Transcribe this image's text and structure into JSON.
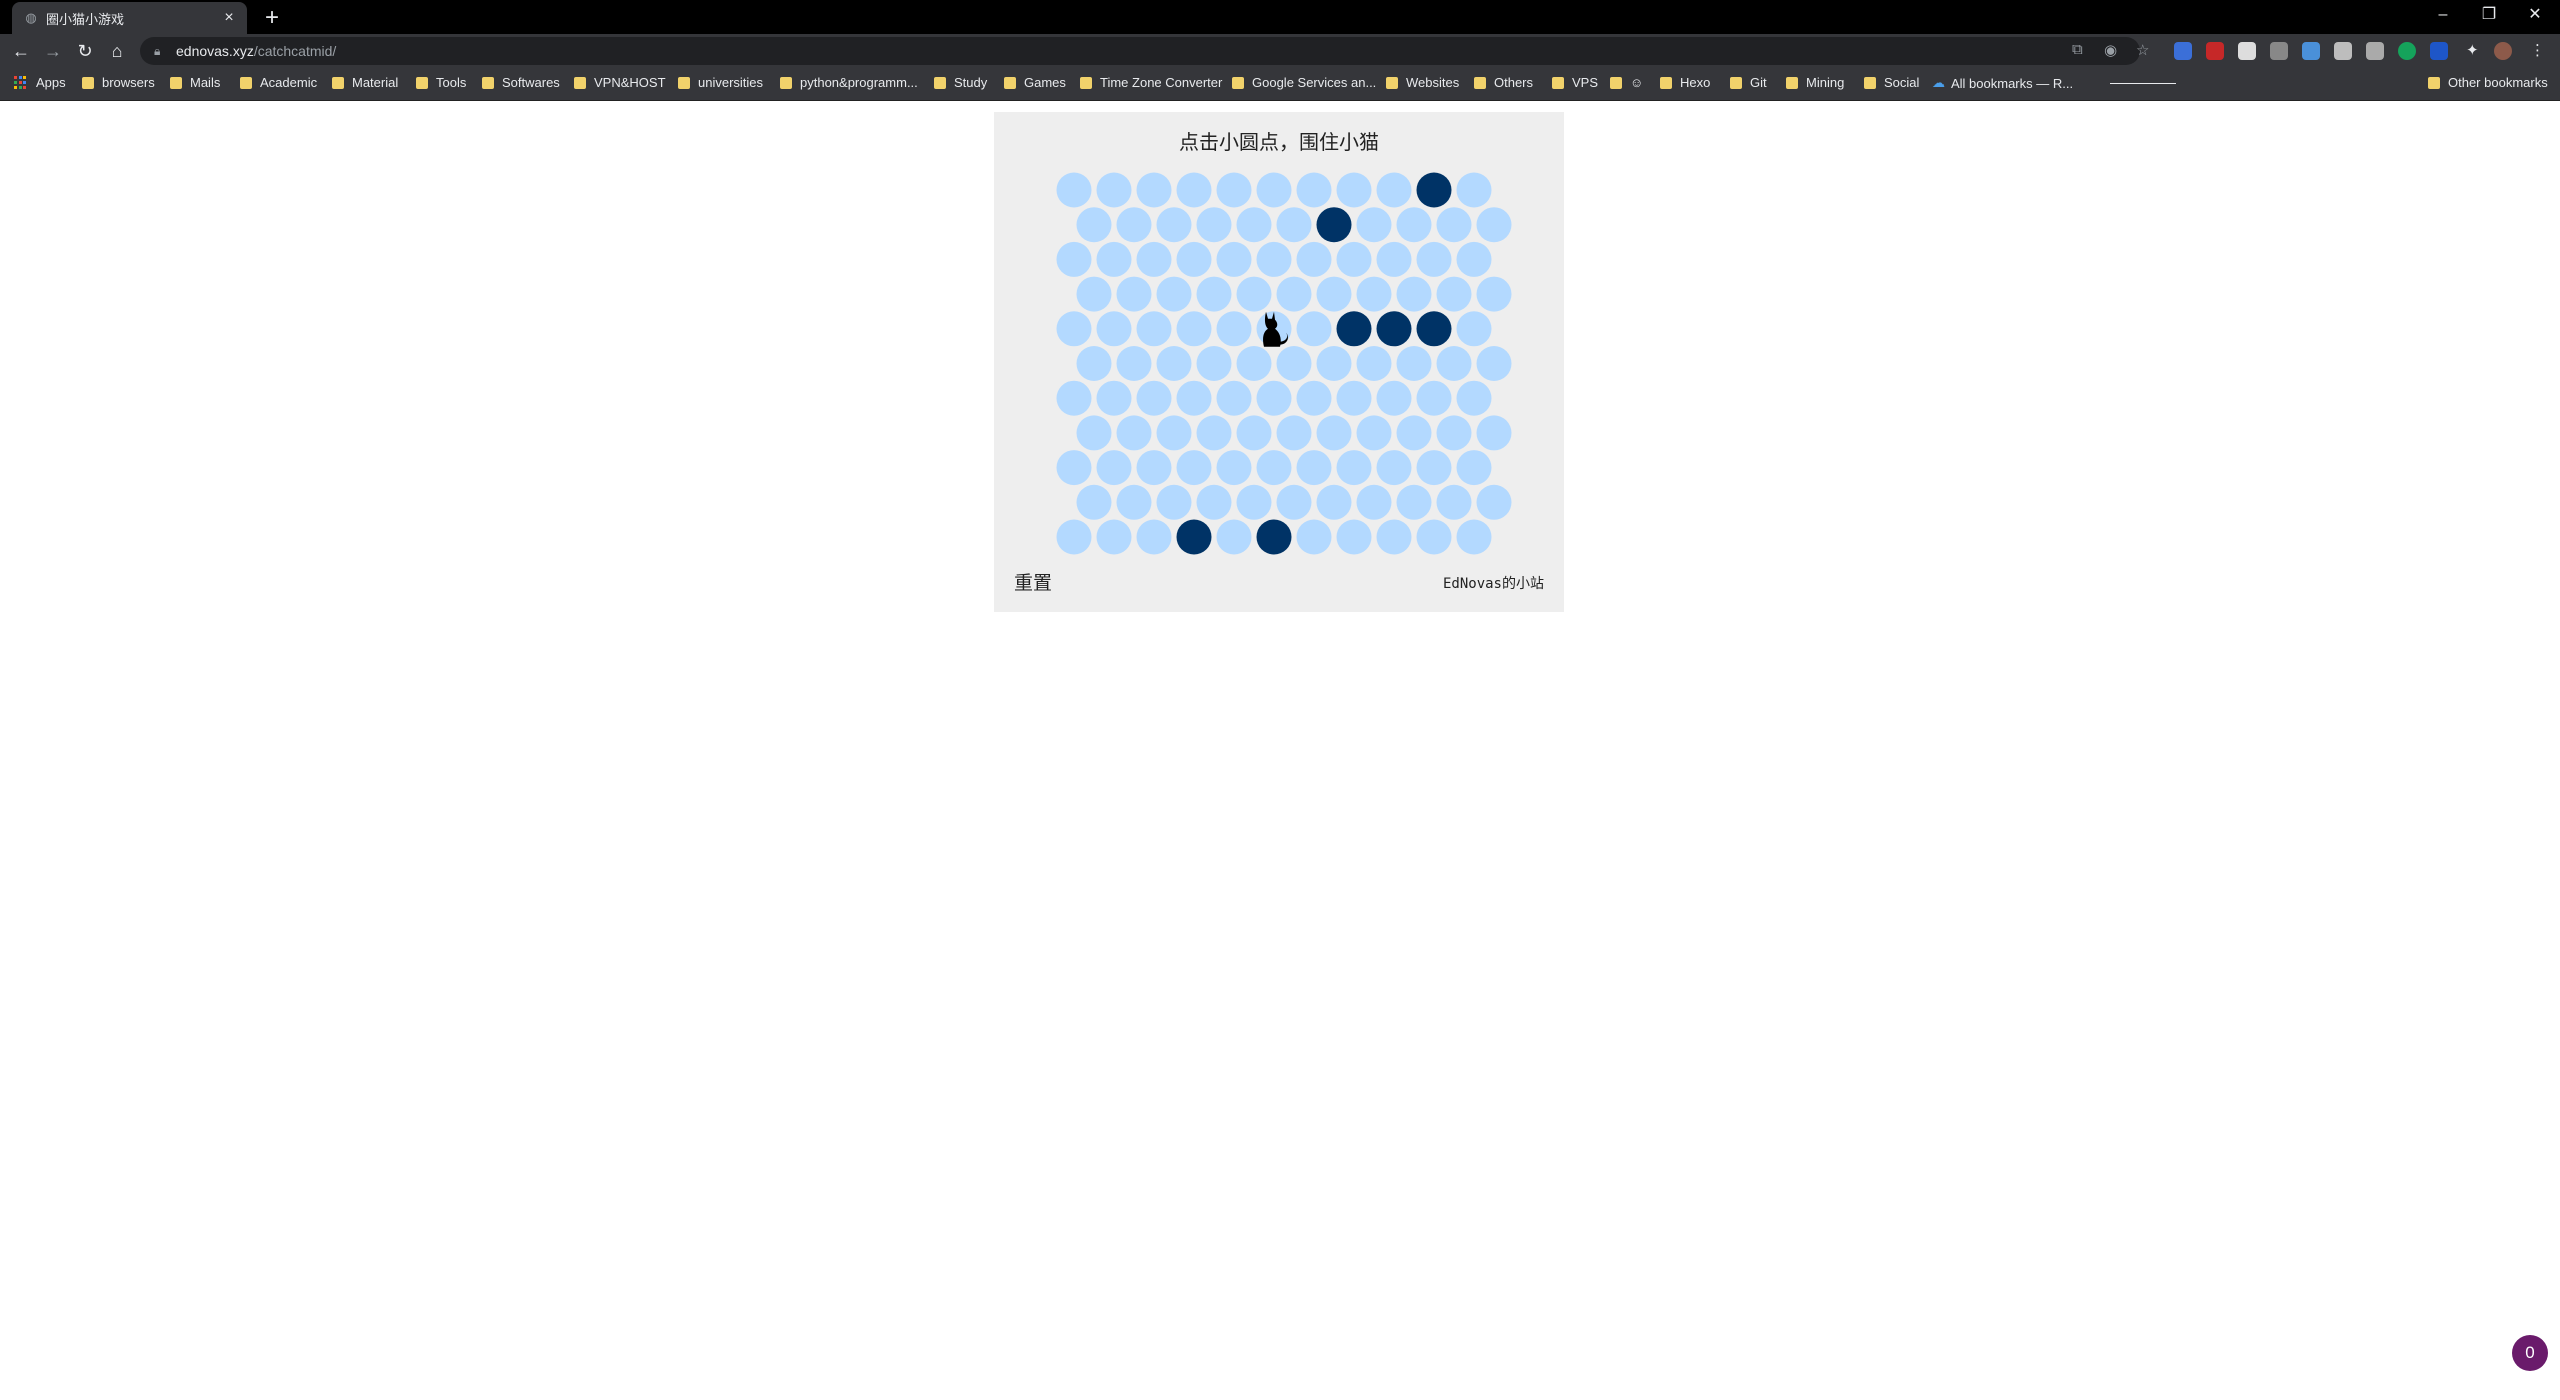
{
  "browser": {
    "tab_title": "圈小猫小游戏",
    "url_host": "ednovas.xyz",
    "url_path": "/catchcatmid/"
  },
  "bookmarks": [
    "Apps",
    "browsers",
    "Mails",
    "Academic",
    "Material",
    "Tools",
    "Softwares",
    "VPN&HOST",
    "universities",
    "python&programm...",
    "Study",
    "Games",
    "Time Zone Converter",
    "Google Services an...",
    "Websites",
    "Others",
    "VPS",
    "",
    "Hexo",
    "Git",
    "Mining",
    "Social",
    "All bookmarks — R..."
  ],
  "other_bookmarks": "Other bookmarks",
  "game": {
    "title": "点击小圆点，围住小猫",
    "reset_label": "重置",
    "credit": "EdNovas的小站",
    "rows": 11,
    "cols": 11,
    "cat": {
      "row": 4,
      "col": 5
    },
    "walls": [
      [
        0,
        9
      ],
      [
        1,
        6
      ],
      [
        4,
        7
      ],
      [
        4,
        8
      ],
      [
        4,
        9
      ],
      [
        10,
        3
      ],
      [
        10,
        5
      ]
    ],
    "colors": {
      "empty": "#b3d9ff",
      "wall": "#003366",
      "cat": "#000000"
    }
  },
  "notification_count": "0"
}
